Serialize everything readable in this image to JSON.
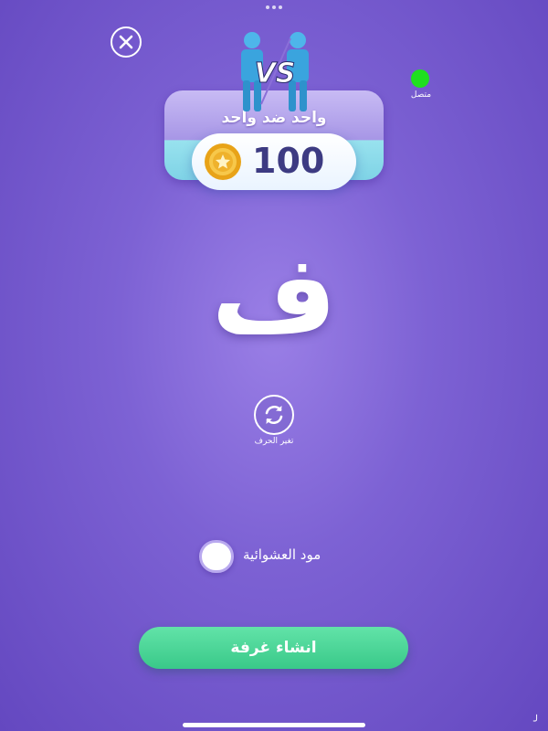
{
  "header": {
    "close_icon": "close-icon",
    "status_label": "متصل",
    "status_color": "#1fe01f"
  },
  "banner": {
    "vs_text": "VS",
    "title": "واحد ضد واحد",
    "coin_icon": "coin-icon",
    "coin_value": "100"
  },
  "letter": {
    "value": "ف"
  },
  "change_letter": {
    "icon": "refresh-icon",
    "label": "تغير الحرف"
  },
  "random_mode": {
    "label": "مود العشوائية",
    "on": false
  },
  "create_room": {
    "label": "انشاء غرفة",
    "color": "#45d394"
  },
  "colors": {
    "background": "#7d62d4",
    "accent": "#45d394"
  }
}
